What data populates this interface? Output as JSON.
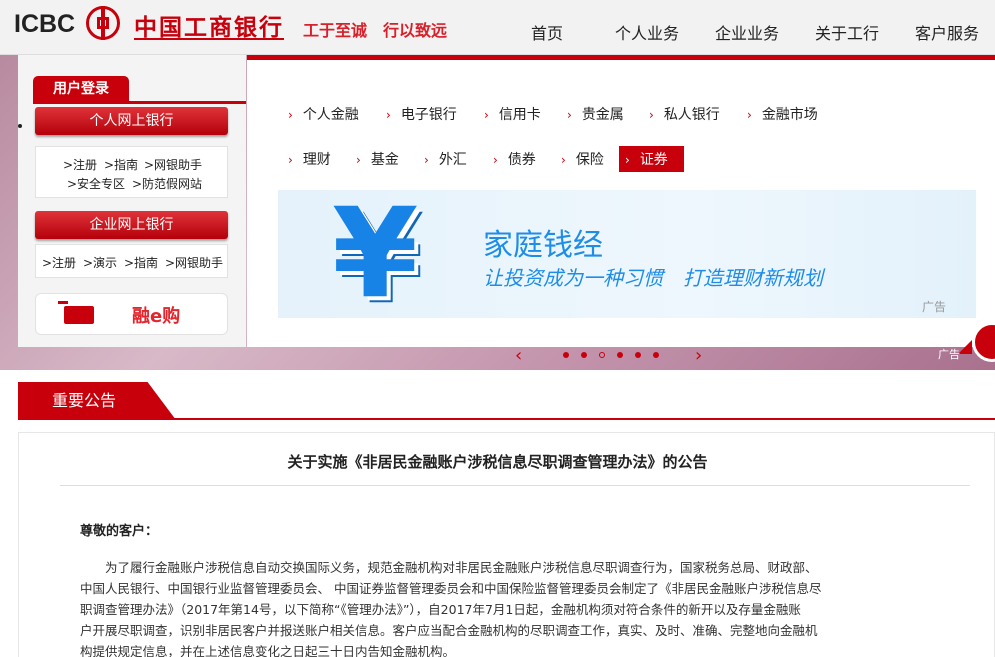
{
  "header": {
    "logo_text": "ICBC",
    "bank_name": "中国工商银行",
    "slogan": "工于至诚　行以致远",
    "nav": [
      "首页",
      "个人业务",
      "企业业务",
      "关于工行",
      "客户服务"
    ]
  },
  "login": {
    "tab_label": "用户登录",
    "personal_button": "个人网上银行",
    "personal_links": [
      ">注册",
      ">指南",
      ">网银助手",
      ">安全专区",
      ">防范假网站"
    ],
    "corporate_button": "企业网上银行",
    "corporate_links": [
      ">注册",
      ">演示",
      ">指南",
      ">网银助手"
    ],
    "ebuy_label": "融e购"
  },
  "subnav": {
    "row1": [
      "个人金融",
      "电子银行",
      "信用卡",
      "贵金属",
      "私人银行",
      "金融市场"
    ],
    "row2": [
      "理财",
      "基金",
      "外汇",
      "债券",
      "保险",
      "证券"
    ],
    "active": "证券"
  },
  "promo": {
    "symbol": "¥",
    "title": "家庭钱经",
    "subtitle": "让投资成为一种习惯　打造理财新规划",
    "ad_label": "广告"
  },
  "carousel": {
    "ad_label_edge": "广告",
    "dot_count": 6,
    "active_index": 2
  },
  "notice": {
    "tab_label": "重要公告",
    "title": "关于实施《非居民金融账户涉税信息尽职调查管理办法》的公告",
    "greeting": "尊敬的客户：",
    "body_lines": [
      "　　为了履行金融账户涉税信息自动交换国际义务，规范金融机构对非居民金融账户涉税信息尽职调查行为，国家税务总局、财政部、",
      "中国人民银行、中国银行业监督管理委员会、 中国证券监督管理委员会和中国保险监督管理委员会制定了《非居民金融账户涉税信息尽",
      "职调查管理办法》（2017年第14号，以下简称“《管理办法》”），自2017年7月1日起，金融机构须对符合条件的新开以及存量金融账",
      "户开展尽职调查，识别非居民客户并报送账户相关信息。客户应当配合金融机构的尽职调查工作，真实、及时、准确、完整地向金融机",
      "构提供规定信息，并在上述信息变化之日起三十日内告知金融机构。"
    ]
  },
  "colors": {
    "brand_red": "#c7000b",
    "promo_blue": "#1e8de8"
  }
}
